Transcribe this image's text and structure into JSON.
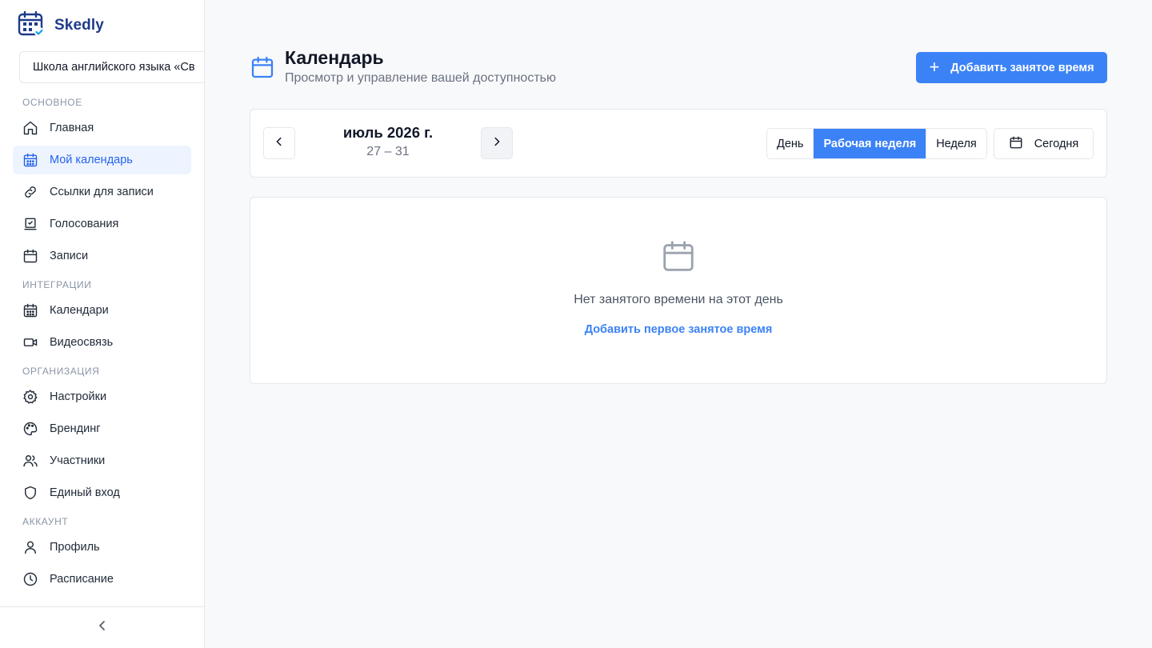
{
  "app": {
    "name": "Skedly",
    "logo_icon": "calendar-check-logo-icon"
  },
  "organization": {
    "name": "Школа английского языка «Св"
  },
  "sidebar": {
    "sections": [
      {
        "title": "ОСНОВНОЕ",
        "items": [
          {
            "label": "Главная",
            "icon": "home-icon",
            "active": false
          },
          {
            "label": "Мой календарь",
            "icon": "calendar-icon",
            "active": true
          },
          {
            "label": "Ссылки для записи",
            "icon": "link-icon",
            "active": false
          },
          {
            "label": "Голосования",
            "icon": "vote-icon",
            "active": false
          },
          {
            "label": "Записи",
            "icon": "calendar-icon",
            "active": false
          }
        ]
      },
      {
        "title": "ИНТЕГРАЦИИ",
        "items": [
          {
            "label": "Календари",
            "icon": "calendar-icon",
            "active": false
          },
          {
            "label": "Видеосвязь",
            "icon": "video-icon",
            "active": false
          }
        ]
      },
      {
        "title": "ОРГАНИЗАЦИЯ",
        "items": [
          {
            "label": "Настройки",
            "icon": "gear-icon",
            "active": false
          },
          {
            "label": "Брендинг",
            "icon": "palette-icon",
            "active": false
          },
          {
            "label": "Участники",
            "icon": "users-icon",
            "active": false
          },
          {
            "label": "Единый вход",
            "icon": "shield-icon",
            "active": false
          }
        ]
      },
      {
        "title": "АККАУНТ",
        "items": [
          {
            "label": "Профиль",
            "icon": "user-icon",
            "active": false
          },
          {
            "label": "Расписание",
            "icon": "clock-icon",
            "active": false
          }
        ]
      }
    ],
    "collapse_icon": "chevron-left-icon"
  },
  "header": {
    "title": "Календарь",
    "subtitle": "Просмотр и управление вашей доступностью",
    "add_button_label": "Добавить занятое время"
  },
  "toolbar": {
    "month": "июль 2026 г.",
    "range": "27 – 31",
    "views": [
      {
        "label": "День",
        "active": false
      },
      {
        "label": "Рабочая неделя",
        "active": true
      },
      {
        "label": "Неделя",
        "active": false
      }
    ],
    "today_label": "Сегодня"
  },
  "empty_state": {
    "text": "Нет занятого времени на этот день",
    "link": "Добавить первое занятое время"
  },
  "colors": {
    "accent": "#3b82f6",
    "brand_text": "#1e3a8a",
    "active_bg": "#eef4ff",
    "background": "#f8f9fb"
  }
}
